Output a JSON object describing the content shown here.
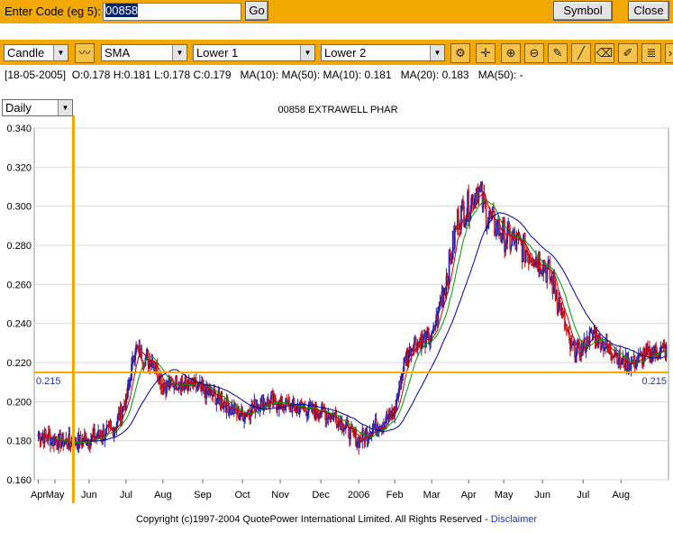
{
  "topbar": {
    "code_label": "Enter Code (eg 5):",
    "code_value": "00858",
    "go_label": "Go",
    "symbol_label": "Symbol",
    "close_label": "Close"
  },
  "toolbar": {
    "chart_type": "Candle",
    "overlay": "SMA",
    "lower1": "Lower 1",
    "lower2": "Lower 2",
    "tools": [
      "draw-trend-icon",
      "settings-icon",
      "crosshair-icon",
      "zoom-in-icon",
      "zoom-out-icon",
      "pencil-icon",
      "line-icon",
      "eraser-icon",
      "edit-icon",
      "stack-icon"
    ]
  },
  "info_line": "[18-05-2005]  O:0.178 H:0.181 L:0.178 C:0.179   MA(10): MA(50): MA(10): 0.181   MA(20): 0.183   MA(50): -",
  "period": "Daily",
  "colors": {
    "accent": "#f2a800",
    "candle": "#cc0000",
    "ma10": "#cc0000",
    "ma20": "#009900",
    "ma50": "#000099",
    "grid": "#d9d9d9",
    "price_line": "#f2a800"
  },
  "chart_data": {
    "type": "candlestick",
    "title": "00858  EXTRAWELL PHAR",
    "ylim": [
      0.16,
      0.34
    ],
    "y_ticks": [
      "0.340",
      "0.320",
      "0.300",
      "0.280",
      "0.260",
      "0.240",
      "0.220",
      "0.200",
      "0.180",
      "0.160"
    ],
    "x_ticks": [
      "Apr",
      "May",
      "Jun",
      "Jul",
      "Aug",
      "Sep",
      "Oct",
      "Nov",
      "Dec",
      "2006",
      "Feb",
      "Mar",
      "Apr",
      "May",
      "Jun",
      "Jul",
      "Aug"
    ],
    "x_tick_index": [
      0,
      18,
      55,
      95,
      135,
      178,
      221,
      262,
      306,
      347,
      386,
      426,
      466,
      504,
      546,
      590,
      631
    ],
    "crosshair_index": 38,
    "price_line": {
      "value": 0.215,
      "label_left": "0.215",
      "label_right": "0.215"
    },
    "series": [
      {
        "name": "MA(10)",
        "color": "#cc0000",
        "period": 10
      },
      {
        "name": "MA(20)",
        "color": "#009900",
        "period": 20
      },
      {
        "name": "MA(50)",
        "color": "#000099",
        "period": 50
      }
    ],
    "close_anchors": [
      [
        0,
        0.183
      ],
      [
        10,
        0.182
      ],
      [
        20,
        0.18
      ],
      [
        38,
        0.179
      ],
      [
        55,
        0.181
      ],
      [
        80,
        0.185
      ],
      [
        95,
        0.2
      ],
      [
        105,
        0.228
      ],
      [
        115,
        0.222
      ],
      [
        125,
        0.221
      ],
      [
        135,
        0.208
      ],
      [
        150,
        0.21
      ],
      [
        170,
        0.208
      ],
      [
        190,
        0.203
      ],
      [
        210,
        0.196
      ],
      [
        221,
        0.193
      ],
      [
        240,
        0.2
      ],
      [
        262,
        0.199
      ],
      [
        280,
        0.197
      ],
      [
        306,
        0.195
      ],
      [
        320,
        0.193
      ],
      [
        347,
        0.18
      ],
      [
        360,
        0.186
      ],
      [
        375,
        0.19
      ],
      [
        386,
        0.195
      ],
      [
        396,
        0.22
      ],
      [
        406,
        0.23
      ],
      [
        426,
        0.232
      ],
      [
        445,
        0.27
      ],
      [
        455,
        0.295
      ],
      [
        466,
        0.3
      ],
      [
        476,
        0.31
      ],
      [
        486,
        0.295
      ],
      [
        495,
        0.29
      ],
      [
        504,
        0.285
      ],
      [
        520,
        0.28
      ],
      [
        530,
        0.277
      ],
      [
        546,
        0.272
      ],
      [
        560,
        0.258
      ],
      [
        570,
        0.24
      ],
      [
        576,
        0.228
      ],
      [
        585,
        0.226
      ],
      [
        590,
        0.228
      ],
      [
        600,
        0.235
      ],
      [
        615,
        0.228
      ],
      [
        625,
        0.225
      ],
      [
        631,
        0.22
      ],
      [
        645,
        0.22
      ],
      [
        660,
        0.224
      ],
      [
        670,
        0.226
      ],
      [
        680,
        0.226
      ]
    ]
  },
  "footer": {
    "copyright": "Copyright (c)1997-2004 QuotePower International Limited. All Rights Reserved - ",
    "disclaimer": "Disclaimer"
  }
}
